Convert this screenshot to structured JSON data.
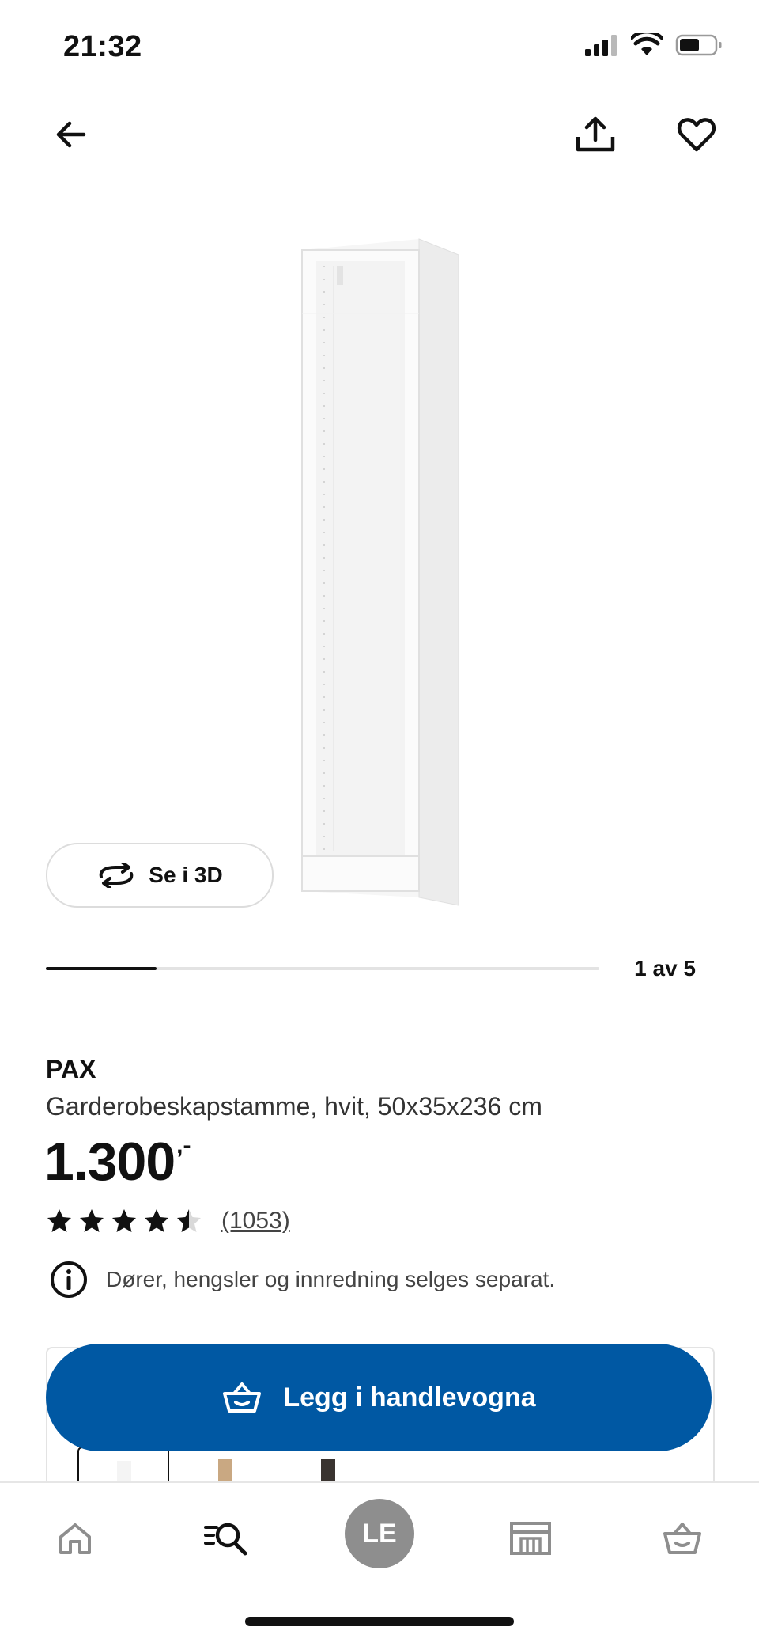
{
  "status_bar": {
    "time": "21:32",
    "icons": [
      "cellular-signal-icon",
      "wifi-icon",
      "battery-icon"
    ]
  },
  "top_nav": {
    "back_icon": "arrow-left-icon",
    "share_icon": "share-icon",
    "favorite_icon": "heart-outline-icon"
  },
  "gallery": {
    "view_3d_label": "Se i 3D",
    "view_3d_icon": "rotate-3d-icon",
    "pager_text": "1 av 5",
    "current_index": 1,
    "total": 5
  },
  "product": {
    "brand": "PAX",
    "description": "Garderobeskapstamme, hvit, 50x35x236 cm",
    "price_integer": "1.300",
    "price_suffix": ",-",
    "rating_value": 4.5,
    "rating_max": 5,
    "rating_count": "(1053)",
    "info_text": "Dører, hengsler og innredning selges separat.",
    "info_icon": "info-circle-icon"
  },
  "cart_button": {
    "label": "Legg i handlevogna",
    "icon": "basket-icon"
  },
  "variants": [
    {
      "name": "white",
      "color": "#f4f4f4",
      "selected": true
    },
    {
      "name": "oak",
      "color": "#c9a882",
      "selected": false
    },
    {
      "name": "black-brown",
      "color": "#3a3430",
      "selected": false
    }
  ],
  "tabbar": {
    "tabs": [
      "home-icon",
      "search-icon",
      "profile-avatar",
      "store-icon",
      "basket-icon"
    ],
    "avatar_initials": "LE",
    "active_tab": "search-icon"
  },
  "colors": {
    "primary_blue": "#0058a3",
    "text": "#111111",
    "muted": "#8e8e8e",
    "border": "#e3e3e3"
  }
}
